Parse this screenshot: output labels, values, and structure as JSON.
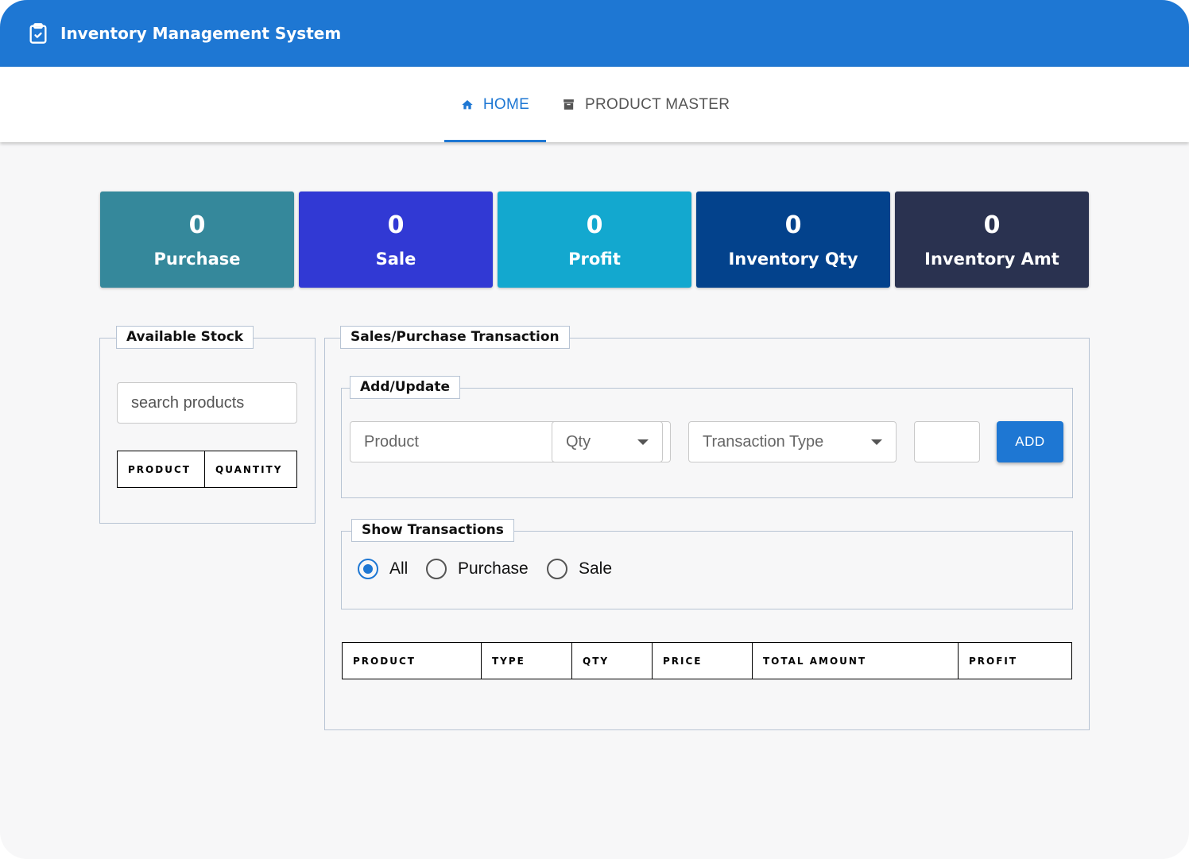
{
  "app": {
    "title": "Inventory Management System",
    "brand_color": "#1e77d3",
    "logo_icon": "clipboard-check-icon"
  },
  "nav": {
    "tabs": [
      {
        "label": "HOME",
        "icon": "home-icon",
        "active": true
      },
      {
        "label": "PRODUCT MASTER",
        "icon": "archive-icon",
        "active": false
      }
    ]
  },
  "summary": [
    {
      "value": "0",
      "label": "Purchase",
      "color": "#35889b"
    },
    {
      "value": "0",
      "label": "Sale",
      "color": "#3139d4"
    },
    {
      "value": "0",
      "label": "Profit",
      "color": "#13a8cf"
    },
    {
      "value": "0",
      "label": "Inventory Qty",
      "color": "#03428c"
    },
    {
      "value": "0",
      "label": "Inventory Amt",
      "color": "#2a3250"
    }
  ],
  "stock": {
    "legend": "Available Stock",
    "search_placeholder": "search products",
    "columns": [
      "PRODUCT",
      "QUANTITY"
    ]
  },
  "transaction": {
    "legend": "Sales/Purchase Transaction",
    "add_update": {
      "legend": "Add/Update",
      "product_placeholder": "Product",
      "qty_label": "Qty",
      "type_label": "Transaction Type",
      "price_value": "",
      "add_label": "ADD"
    },
    "show": {
      "legend": "Show Transactions",
      "options": [
        {
          "label": "All",
          "checked": true
        },
        {
          "label": "Purchase",
          "checked": false
        },
        {
          "label": "Sale",
          "checked": false
        }
      ]
    },
    "columns": [
      "PRODUCT",
      "TYPE",
      "QTY",
      "PRICE",
      "TOTAL AMOUNT",
      "PROFIT"
    ]
  }
}
